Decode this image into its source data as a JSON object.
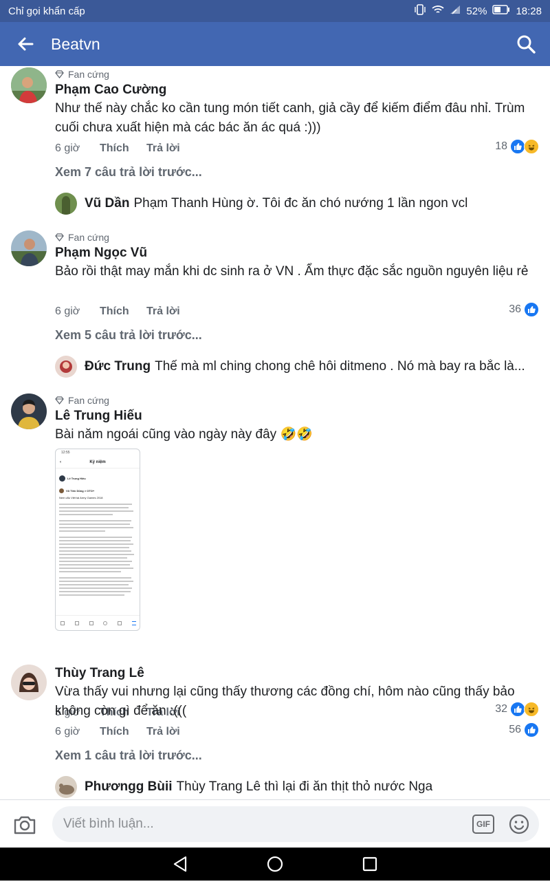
{
  "status_bar": {
    "carrier": "Chỉ gọi khẩn cấp",
    "battery": "52%",
    "time": "18:28"
  },
  "header": {
    "title": "Beatvn"
  },
  "comments": [
    {
      "badge": "Fan cứng",
      "name": "Phạm Cao Cường",
      "text": "Như thế này chắc ko cần tung món tiết canh, giả cầy để kiếm điểm đâu nhỉ. Trùm cuối chưa xuất hiện mà các bác ăn ác quá :)))",
      "time": "6 giờ",
      "like": "Thích",
      "reply": "Trả lời",
      "reaction_count": "18",
      "more_replies": "Xem 7 câu trả lời trước...",
      "reply_name": "Vũ Dần",
      "reply_text": "Phạm Thanh Hùng ờ. Tôi đc ăn chó nướng 1 lần ngon vcl"
    },
    {
      "badge": "Fan cứng",
      "name": "Phạm Ngọc Vũ",
      "text": "Bảo rồi thật may mắn khi dc sinh ra ở VN . Ẩm thực đặc sắc  nguồn nguyên liệu rẻ",
      "time": "6 giờ",
      "like": "Thích",
      "reply": "Trả lời",
      "reaction_count": "36",
      "more_replies": "Xem 5 câu trả lời trước...",
      "reply_name": "Đức Trung",
      "reply_text": "Thế mà ml ching chong chê hôi ditmeno . Nó mà bay ra bắc là..."
    },
    {
      "badge": "Fan cứng",
      "name": "Lê Trung Hiếu",
      "text": "Bài năm ngoái cũng vào ngày này đây 🤣🤣",
      "time": "5 giờ",
      "like": "Thích",
      "reply": "Trả lời",
      "reaction_count": "32",
      "attachment": {
        "time": "12:55",
        "header": "Kỷ niệm",
        "author": "Lê Trung Hiếu",
        "shared": "Vũ Tiến Dũng > OTO+",
        "heading": "Nem cẩu Việt tại Army Games 2018"
      }
    },
    {
      "name": "Thùy Trang Lê",
      "text": "Vừa thấy vui nhưng lại cũng thấy thương các đồng chí, hôm nào cũng thấy bảo không còn gì để ăn :(((",
      "time": "6 giờ",
      "like": "Thích",
      "reply": "Trả lời",
      "reaction_count": "56",
      "more_replies": "Xem 1 câu trả lời trước...",
      "reply_name": "Phươngg Bùii",
      "reply_text": "Thùy Trang Lê thì lại đi ăn thịt thỏ nước Nga"
    }
  ],
  "composer": {
    "placeholder": "Viết bình luận...",
    "gif_label": "GIF"
  },
  "colors": {
    "brand": "#4267b2",
    "status": "#3b5998",
    "like_blue": "#1877f2",
    "haha_yellow": "#f7b928"
  }
}
